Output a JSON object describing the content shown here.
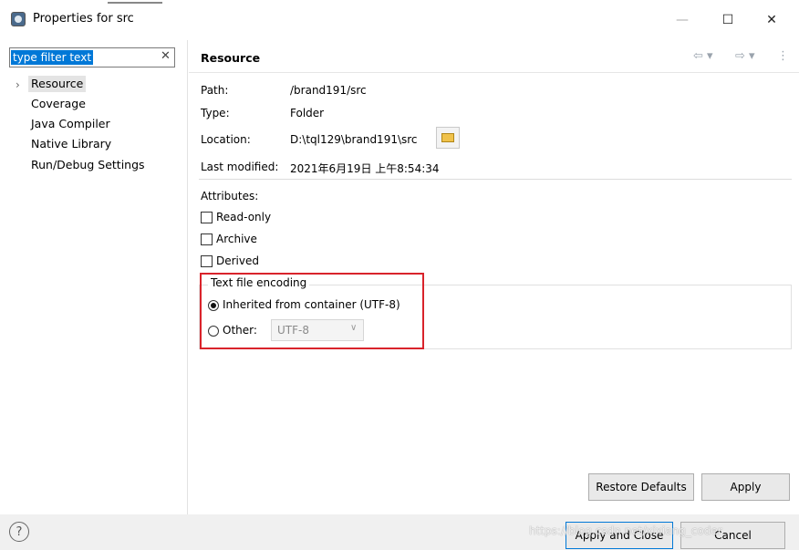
{
  "window": {
    "title": "Properties for src",
    "minimize_glyph": "—",
    "maximize_glyph": "☐",
    "close_glyph": "✕"
  },
  "sidebar": {
    "filter_placeholder": "type filter text",
    "filter_clear_glyph": "✕",
    "items": [
      {
        "label": "Resource",
        "selected": true
      },
      {
        "label": "Coverage"
      },
      {
        "label": "Java Compiler"
      },
      {
        "label": "Native Library"
      },
      {
        "label": "Run/Debug Settings"
      }
    ]
  },
  "header": {
    "title": "Resource",
    "nav_back": "⇦ ▾",
    "nav_forward": "⇨ ▾",
    "menu": "⋮"
  },
  "info": {
    "path_label": "Path:",
    "path_value": "/brand191/src",
    "type_label": "Type:",
    "type_value": "Folder",
    "location_label": "Location:",
    "location_value": "D:\\tql129\\brand191\\src",
    "modified_label": "Last modified:",
    "modified_value": "2021年6月19日 上午8:54:34"
  },
  "attributes": {
    "heading": "Attributes:",
    "read_only": "Read-only",
    "archive": "Archive",
    "derived": "Derived"
  },
  "encoding": {
    "group_title": "Text file encoding",
    "inherited_label": "Inherited from container (UTF-8)",
    "other_label": "Other:",
    "other_value": "UTF-8",
    "combo_arrow": "∨"
  },
  "buttons": {
    "restore_defaults": "Restore Defaults",
    "apply": "Apply",
    "apply_and_close": "Apply and Close",
    "cancel": "Cancel",
    "help_glyph": "?"
  },
  "watermark": "https://blog.csdn.net/xixiang_coder",
  "colors": {
    "selection": "#0078d7",
    "highlight_border": "#d9232b"
  }
}
